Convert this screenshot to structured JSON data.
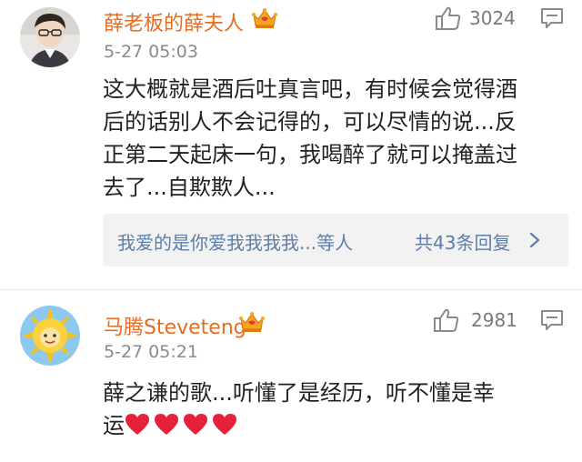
{
  "colors": {
    "username": "#e86c1e",
    "link": "#5b7eab",
    "text": "#222222",
    "meta": "#8a8a8a",
    "heart": "#e8213a",
    "badge": "#f5a623"
  },
  "comments": [
    {
      "user": "薛老板的薛夫人",
      "vip_icon": "crown-vip-icon",
      "time": "5-27 05:03",
      "likes": "3024",
      "lines": [
        "这大概就是酒后吐真言吧，有时候会觉得酒",
        "后的话别人不会记得的，可以尽情的说...反",
        "正第二天起床一句，我喝醉了就可以掩盖过",
        "去了...自欺欺人..."
      ],
      "replies_preview": "我爱的是你爱我我我我...等人",
      "replies_count": "共43条回复"
    },
    {
      "user": "马腾Steveteng",
      "vip_icon": "crown-vip-icon",
      "time": "5-27 05:21",
      "likes": "2981",
      "lines": [
        "薛之谦的歌...听懂了是经历，听不懂是幸",
        "运"
      ],
      "hearts": 4
    }
  ]
}
